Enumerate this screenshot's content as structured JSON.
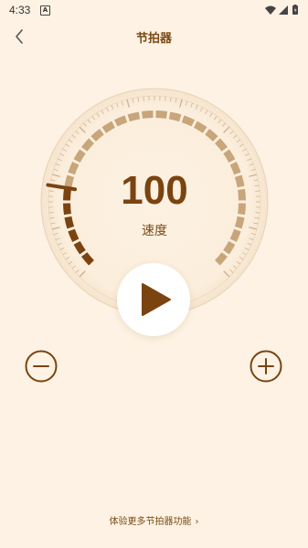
{
  "status_bar": {
    "time": "4:33",
    "app_icon_letter": "A"
  },
  "header": {
    "title": "节拍器"
  },
  "dial": {
    "tempo": "100",
    "tempo_label": "速度"
  },
  "footer": {
    "link_text": "体验更多节拍器功能",
    "chevron": "›"
  },
  "colors": {
    "background": "#fdf2e3",
    "accent": "#7a4310",
    "ring_light": "#c8a57a"
  }
}
